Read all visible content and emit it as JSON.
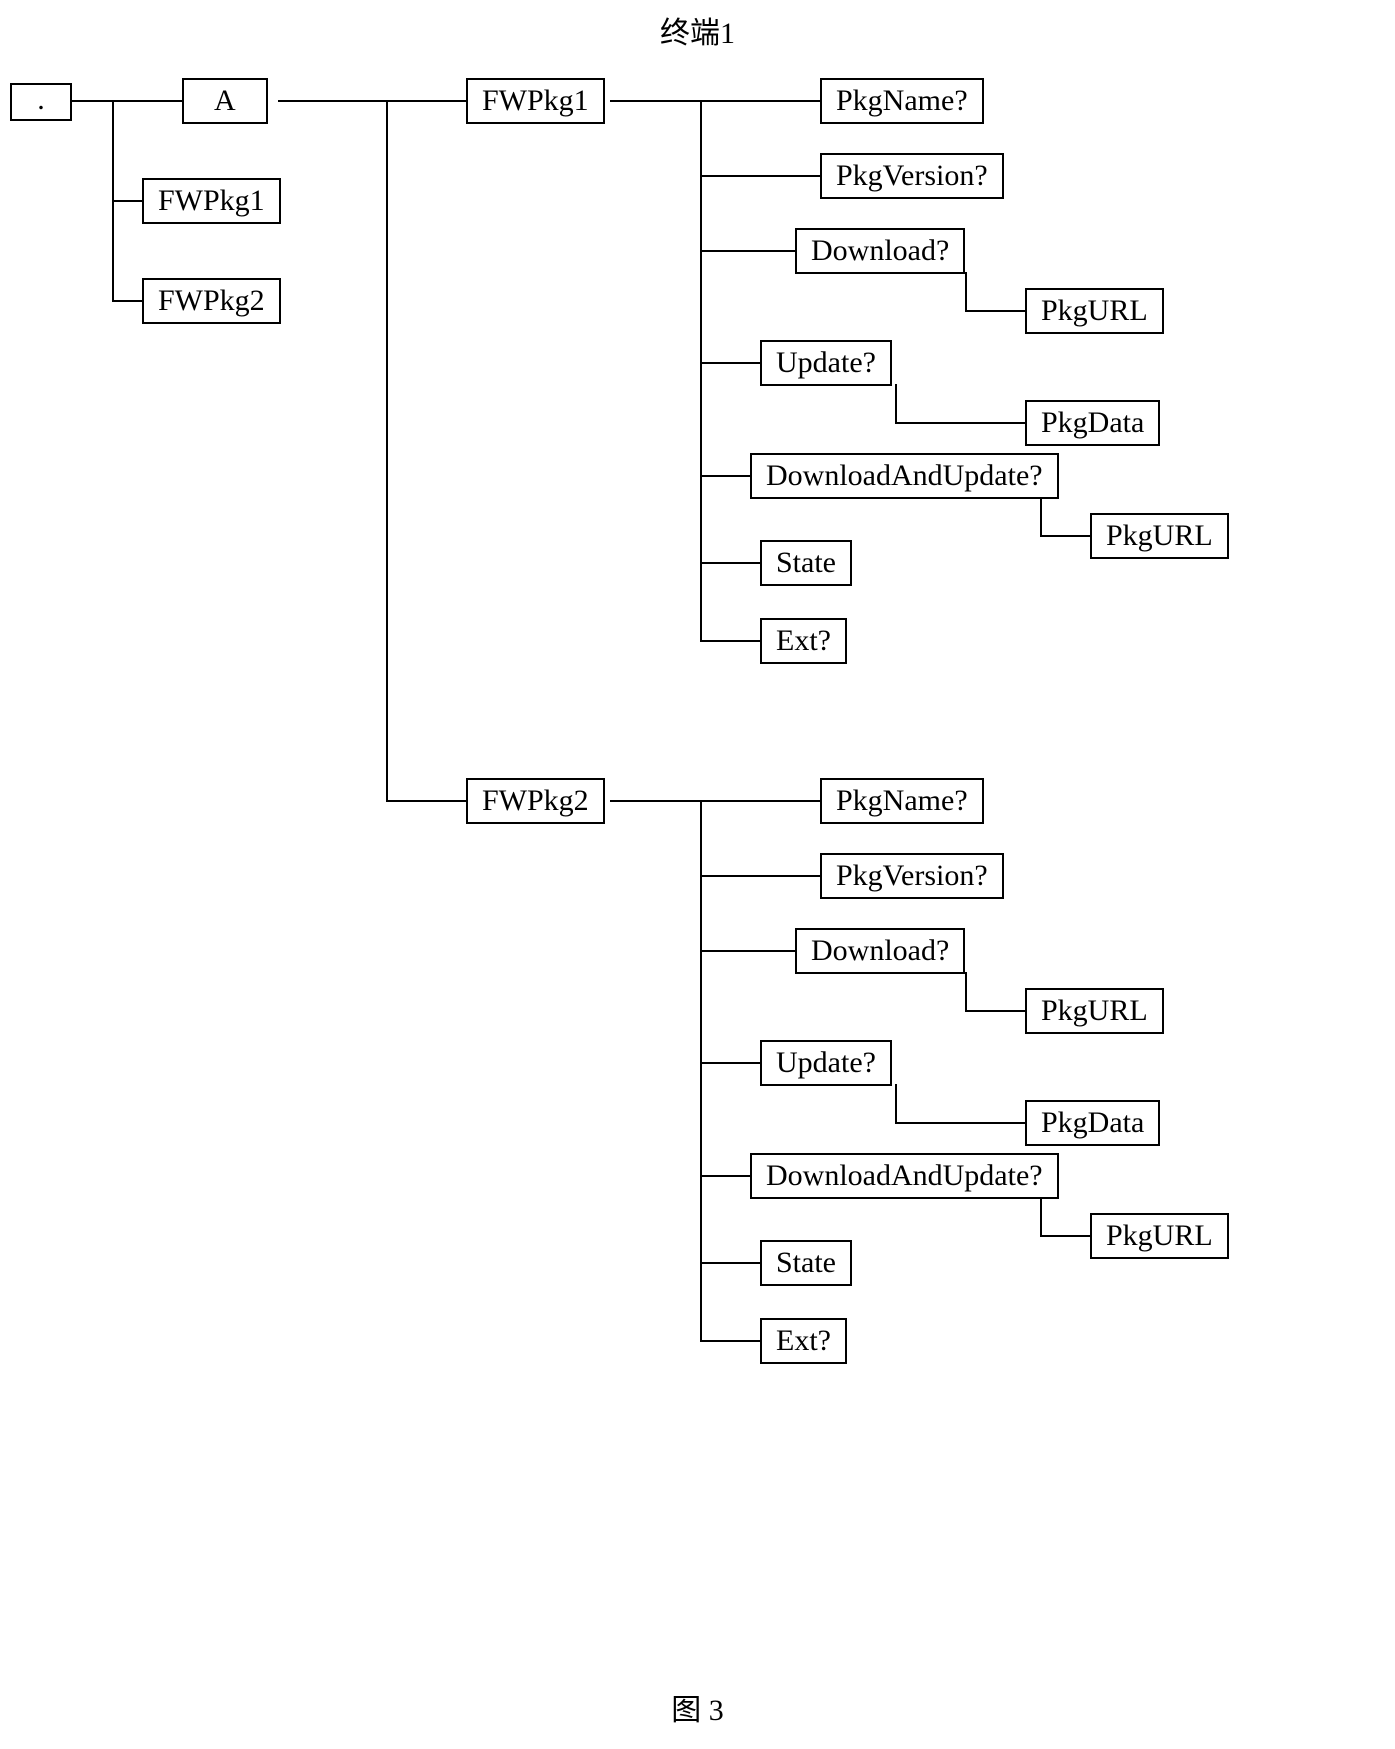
{
  "title": "终端1",
  "caption": "图 3",
  "nodes": {
    "root": ".",
    "a": "A",
    "left_pkg1": "FWPkg1",
    "left_pkg2": "FWPkg2",
    "mid_pkg1": "FWPkg1",
    "mid_pkg2": "FWPkg2",
    "pkgName": "PkgName?",
    "pkgVersion": "PkgVersion?",
    "download": "Download?",
    "pkgURL": "PkgURL",
    "update": "Update?",
    "pkgData": "PkgData",
    "downloadAndUpdate": "DownloadAndUpdate?",
    "state": "State",
    "ext": "Ext?"
  }
}
